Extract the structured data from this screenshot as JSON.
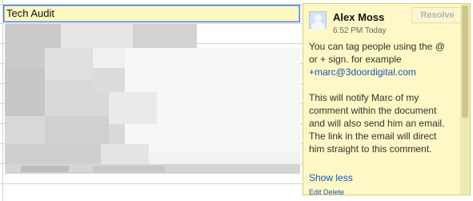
{
  "sheet": {
    "title_cell": "Tech Audit"
  },
  "comment": {
    "author": "Alex Moss",
    "timestamp": "6:52 PM Today",
    "resolve_label": "Resolve",
    "body_line1": "You can tag people using the @ or + sign. for example",
    "body_link": "+marc@3doordigital.com",
    "body_para2": "This will notify Marc of my comment within the document and will also send him an email. The link in the email will direct him straight to this comment.",
    "show_less_label": "Show less",
    "edit_delete_label": "Edit Delete",
    "avatar_icon": "user-avatar-icon"
  }
}
